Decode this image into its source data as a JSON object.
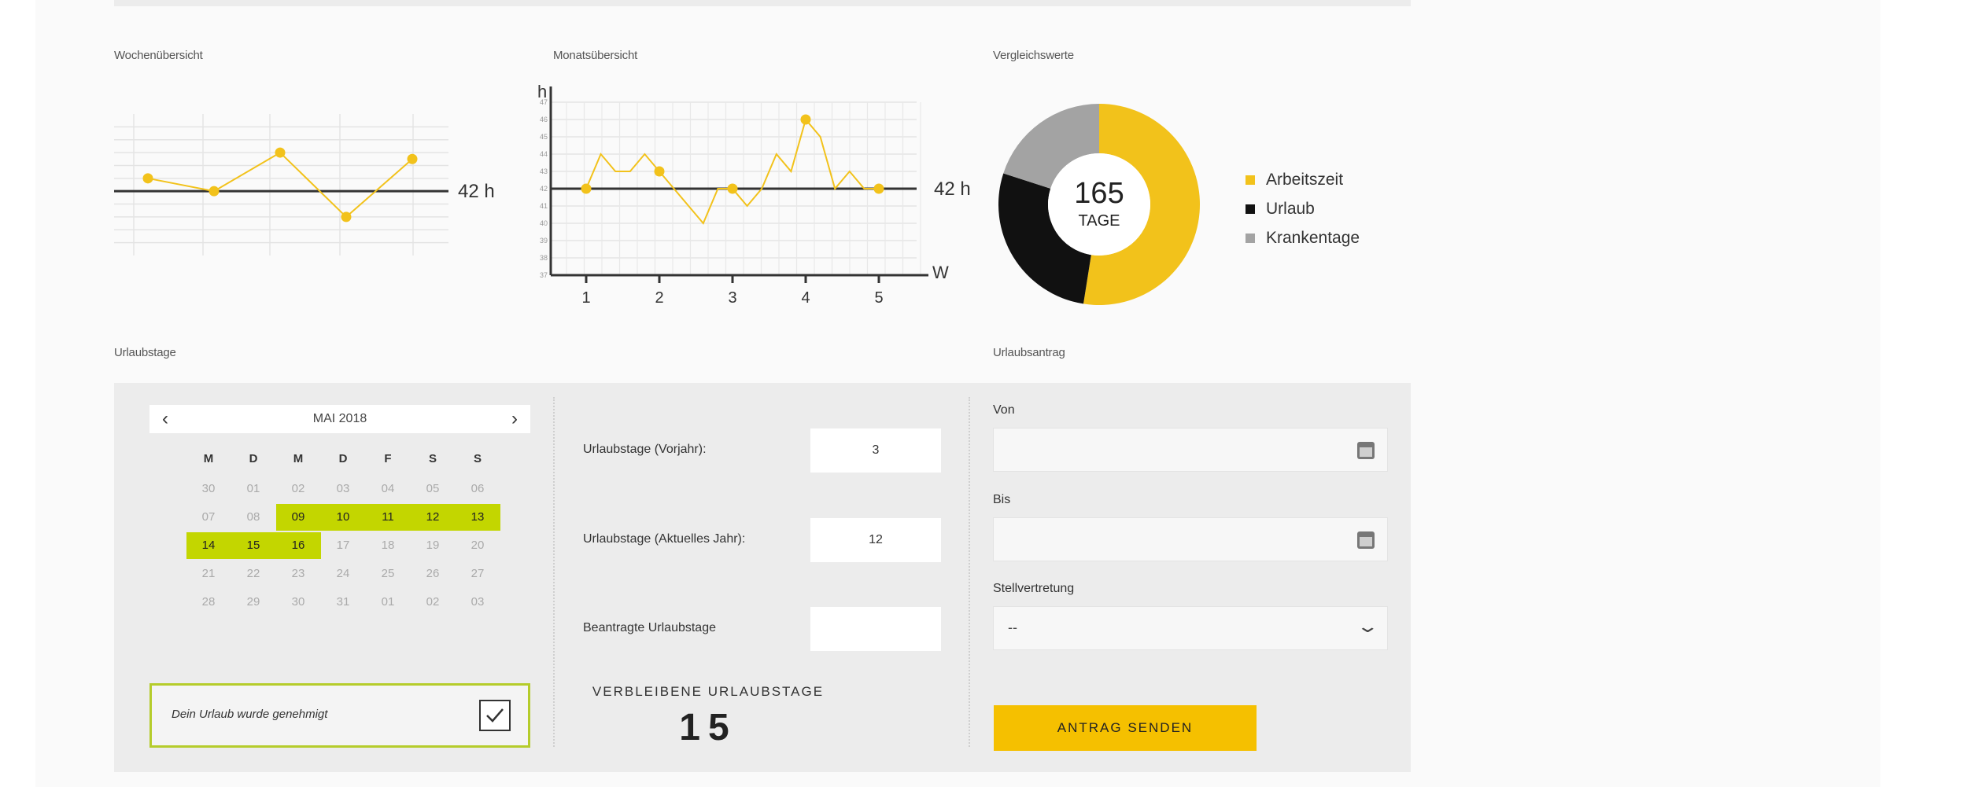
{
  "sections": {
    "weekly": "Wochenübersicht",
    "monthly": "Monatsübersicht",
    "comparison": "Vergleichswerte",
    "vacation_days": "Urlaubstage",
    "vacation_request": "Urlaubsantrag"
  },
  "chart_data": [
    {
      "type": "line",
      "title": "Wochenübersicht",
      "x": [
        1,
        2,
        3,
        4,
        5
      ],
      "series": [
        {
          "values": [
            43,
            42,
            45,
            40,
            44.5
          ]
        }
      ],
      "ylim": [
        37,
        48
      ],
      "reference_line": {
        "value": 42,
        "label": "42 h"
      },
      "grid": true,
      "color": "#f2c21b"
    },
    {
      "type": "line",
      "title": "Monatsübersicht",
      "ylabel": "h",
      "xlabel": "W",
      "x_ticks": [
        "1",
        "2",
        "3",
        "4",
        "5"
      ],
      "y_ticks": [
        "37",
        "38",
        "39",
        "40",
        "41",
        "42",
        "43",
        "44",
        "45",
        "46",
        "47"
      ],
      "ylim": [
        37,
        47
      ],
      "x": [
        1,
        1.2,
        1.4,
        1.6,
        1.8,
        2,
        2.2,
        2.4,
        2.6,
        2.8,
        3,
        3.2,
        3.4,
        3.6,
        3.8,
        4,
        4.2,
        4.4,
        4.6,
        4.8,
        5
      ],
      "series": [
        {
          "values": [
            42,
            44,
            43,
            43,
            44,
            43,
            42,
            41,
            40,
            42,
            42,
            41,
            42,
            44,
            43,
            46,
            45,
            42,
            43,
            42,
            42
          ]
        }
      ],
      "markers_at": [
        1,
        2,
        3,
        4,
        5
      ],
      "reference_line": {
        "value": 42,
        "label": "42 h"
      },
      "grid": true,
      "color": "#f2c21b"
    },
    {
      "type": "pie",
      "title": "Vergleichswerte",
      "center_value": "165",
      "center_label": "TAGE",
      "slices": [
        {
          "label": "Arbeitszeit",
          "value": 0.525,
          "color": "#f2c21b"
        },
        {
          "label": "Urlaub",
          "value": 0.275,
          "color": "#111111"
        },
        {
          "label": "Krankentage",
          "value": 0.2,
          "color": "#a3a3a3"
        }
      ],
      "legend_position": "right"
    }
  ],
  "calendar": {
    "prev": "‹",
    "next": "›",
    "month": "MAI 2018",
    "weekdays": [
      "M",
      "D",
      "M",
      "D",
      "F",
      "S",
      "S"
    ],
    "weeks": [
      [
        "30",
        "01",
        "02",
        "03",
        "04",
        "05",
        "06"
      ],
      [
        "07",
        "08",
        "09",
        "10",
        "11",
        "12",
        "13"
      ],
      [
        "14",
        "15",
        "16",
        "17",
        "18",
        "19",
        "20"
      ],
      [
        "21",
        "22",
        "23",
        "24",
        "25",
        "26",
        "27"
      ],
      [
        "28",
        "29",
        "30",
        "31",
        "01",
        "02",
        "03"
      ]
    ],
    "selected": [
      "09",
      "10",
      "11",
      "12",
      "13",
      "14",
      "15",
      "16"
    ],
    "highlight_color": "#c3d600"
  },
  "approval": {
    "text": "Dein Urlaub wurde genehmigt",
    "checked": true
  },
  "stats": {
    "prev_year_label": "Urlaubstage (Vorjahr):",
    "prev_year_value": "3",
    "current_year_label": "Urlaubstage (Aktuelles Jahr):",
    "current_year_value": "12",
    "requested_label": "Beantragte Urlaubstage",
    "requested_value": "",
    "remaining_label": "VERBLEIBENE URLAUBSTAGE",
    "remaining_value": "15"
  },
  "form": {
    "from_label": "Von",
    "to_label": "Bis",
    "deputy_label": "Stellvertretung",
    "deputy_value": "--",
    "submit": "ANTRAG SENDEN",
    "icons": [
      "calendar-icon",
      "chevron-down-icon",
      "checkmark-icon"
    ]
  }
}
